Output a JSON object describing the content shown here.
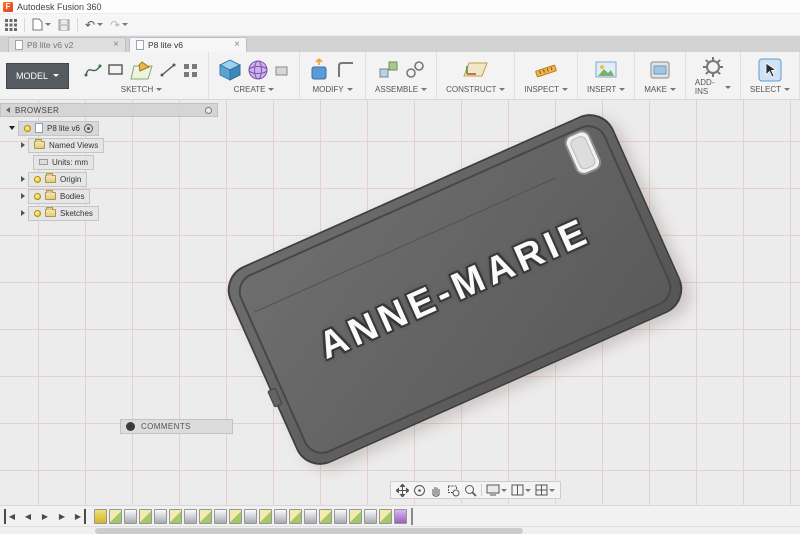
{
  "app": {
    "title": "Autodesk Fusion 360",
    "logo_letter": "F"
  },
  "quickbar": {
    "undo_glyph": "↶",
    "redo_glyph": "↷"
  },
  "tabs": {
    "close_glyph": "×",
    "items": [
      {
        "label": "P8 lite v6 v2"
      },
      {
        "label": "P8 lite v6"
      }
    ]
  },
  "toolbar": {
    "model_label": "MODEL",
    "groups": [
      {
        "label": "SKETCH"
      },
      {
        "label": "CREATE"
      },
      {
        "label": "MODIFY"
      },
      {
        "label": "ASSEMBLE"
      },
      {
        "label": "CONSTRUCT"
      },
      {
        "label": "INSPECT"
      },
      {
        "label": "INSERT"
      },
      {
        "label": "MAKE"
      },
      {
        "label": "ADD-INS"
      },
      {
        "label": "SELECT"
      }
    ]
  },
  "browser": {
    "header": "BROWSER",
    "root_label": "P8 lite v6",
    "items": [
      {
        "label": "Named Views"
      },
      {
        "label": "Units: mm"
      },
      {
        "label": "Origin"
      },
      {
        "label": "Bodies"
      },
      {
        "label": "Sketches"
      }
    ]
  },
  "canvas": {
    "engraving_text": "ANNE-MARIE",
    "body_color": "#5f5f5f",
    "grid_color": "#e6cfcd"
  },
  "comments": {
    "label": "COMMENTS"
  },
  "navbar": {
    "icons": [
      "pan",
      "orbit",
      "pan-hand",
      "zoom-window",
      "zoom",
      "display-settings",
      "layout",
      "viewports"
    ]
  },
  "timeline": {
    "controls": {
      "to_start": "◀",
      "step_back": "◀",
      "play": "▶",
      "step_forward": "▶",
      "to_end": "▶"
    },
    "icons": [
      "base",
      "sketch",
      "extrude",
      "sketch",
      "extrude",
      "sketch",
      "extrude",
      "sketch",
      "extrude",
      "sketch",
      "extrude",
      "sketch",
      "extrude",
      "sketch",
      "extrude",
      "sketch",
      "extrude",
      "sketch",
      "extrude",
      "sketch",
      "text"
    ]
  }
}
